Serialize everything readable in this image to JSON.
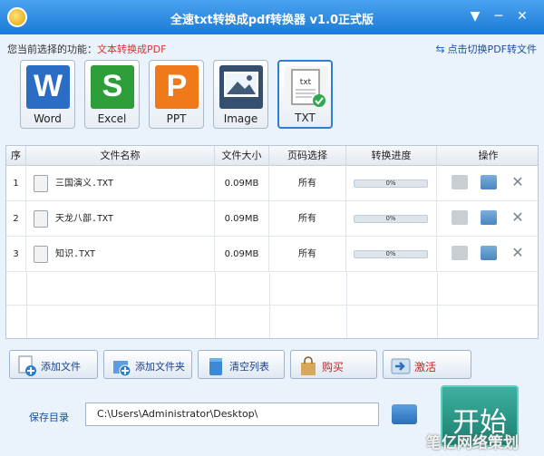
{
  "window": {
    "title": "全速txt转换成pdf转换器 v1.0正式版",
    "minimize_glyph": "▼",
    "restore_glyph": "─",
    "close_glyph": "✕"
  },
  "function_bar": {
    "label": "您当前选择的功能：",
    "current": "文本转换成PDF",
    "switch_label": "点击切换PDF转文件",
    "switch_glyph": "⇆"
  },
  "formats": [
    {
      "caption": "Word",
      "letter": "W",
      "color": "#2b6cc4",
      "icon": "word-icon"
    },
    {
      "caption": "Excel",
      "letter": "S",
      "color": "#2e9e3a",
      "icon": "excel-icon"
    },
    {
      "caption": "PPT",
      "letter": "P",
      "color": "#f07a1a",
      "icon": "ppt-icon"
    },
    {
      "caption": "Image",
      "letter": "",
      "color": "#34506e",
      "icon": "image-icon"
    },
    {
      "caption": "TXT",
      "letter": "",
      "color": "#e8e8e8",
      "icon": "txt-icon"
    }
  ],
  "table": {
    "headers": [
      "序",
      "文件名称",
      "文件大小",
      "页码选择",
      "转换进度",
      "操作"
    ],
    "rows": [
      {
        "index": "1",
        "name": "三国演义.TXT",
        "size": "0.09MB",
        "pages": "所有",
        "progress": "0%",
        "progress_value": 0
      },
      {
        "index": "2",
        "name": "天龙八部.TXT",
        "size": "0.09MB",
        "pages": "所有",
        "progress": "0%",
        "progress_value": 0
      },
      {
        "index": "3",
        "name": "知识.TXT",
        "size": "0.09MB",
        "pages": "所有",
        "progress": "0%",
        "progress_value": 0
      }
    ],
    "delete_glyph": "✕"
  },
  "buttons": {
    "add_file": "添加文件",
    "add_folder": "添加文件夹",
    "clear_list": "清空列表",
    "buy": "购买",
    "activate": "激活"
  },
  "save": {
    "label": "保存目录",
    "path": "C:\\Users\\Administrator\\Desktop\\"
  },
  "start": {
    "label": "开始"
  },
  "watermark": "笔亿网络策划"
}
